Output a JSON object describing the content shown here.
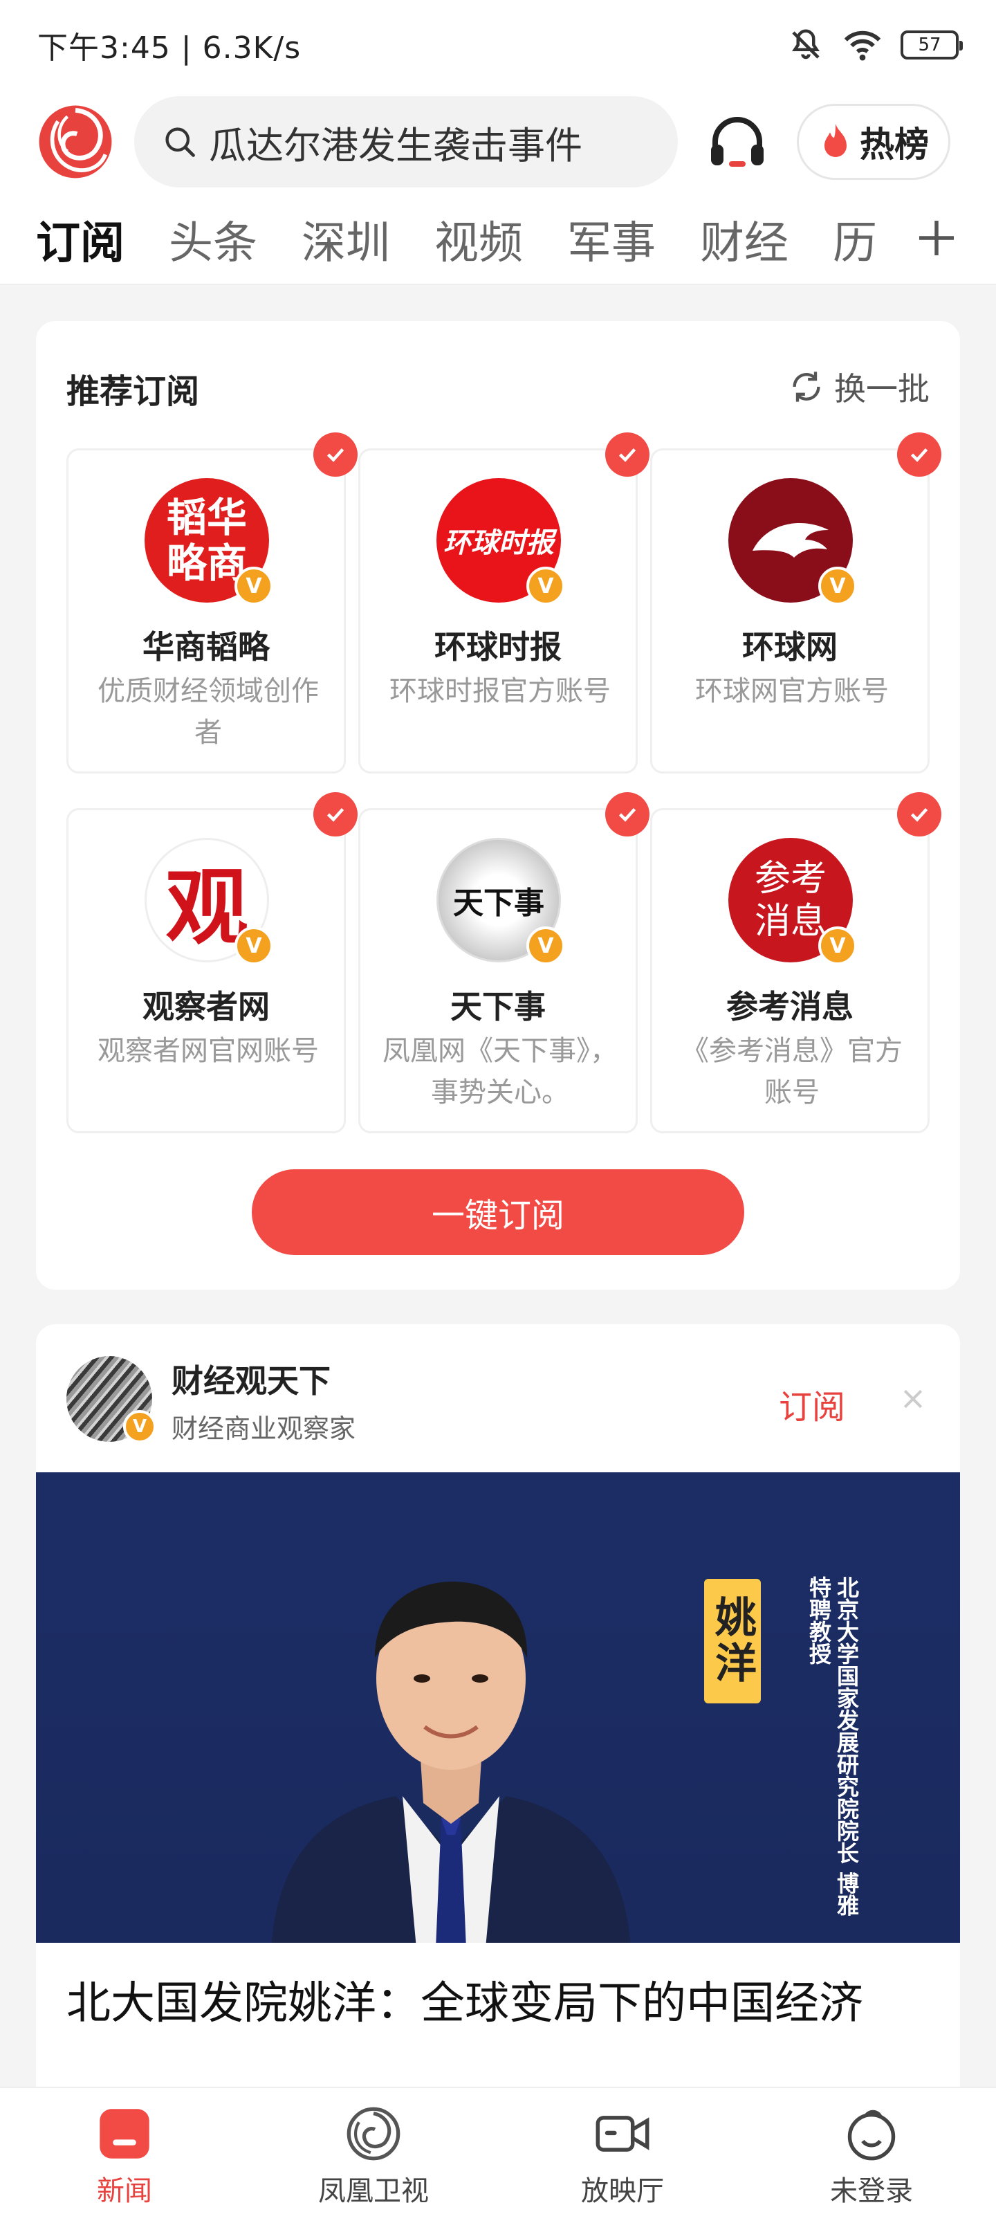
{
  "status_bar": {
    "time_speed": "下午3:45 | 6.3K/s",
    "battery": "57"
  },
  "header": {
    "search_text": "瓜达尔港发生袭击事件",
    "hot_label": "热榜"
  },
  "tabs": [
    "订阅",
    "头条",
    "深圳",
    "视频",
    "军事",
    "财经",
    "历"
  ],
  "recommend": {
    "title": "推荐订阅",
    "refresh_label": "换一批",
    "items": [
      {
        "name": "华商韬略",
        "desc": "优质财经领域创作者",
        "logo_text": "韬华略商"
      },
      {
        "name": "环球时报",
        "desc": "环球时报官方账号",
        "logo_text": "环球时报"
      },
      {
        "name": "环球网",
        "desc": "环球网官方账号",
        "logo_text": ""
      },
      {
        "name": "观察者网",
        "desc": "观察者网官网账号",
        "logo_text": "观"
      },
      {
        "name": "天下事",
        "desc": "凤凰网《天下事》，事势关心。",
        "logo_text": "天下事"
      },
      {
        "name": "参考消息",
        "desc": "《参考消息》官方账号",
        "logo_text": "参考消息"
      }
    ],
    "subscribe_all": "一键订阅",
    "verified_mark": "V"
  },
  "feed": {
    "author": "财经观天下",
    "author_desc": "财经商业观察家",
    "follow_label": "订阅",
    "cover_name": "姚洋",
    "cover_title": "北京大学国家发展研究院院长 博雅特聘教授",
    "title": "北大国发院姚洋：全球变局下的中国经济"
  },
  "bottom_nav": [
    {
      "label": "新闻",
      "icon": "news-icon"
    },
    {
      "label": "凤凰卫视",
      "icon": "phoenix-tv-icon"
    },
    {
      "label": "放映厅",
      "icon": "video-camera-icon"
    },
    {
      "label": "未登录",
      "icon": "user-icon"
    }
  ],
  "colors": {
    "accent": "#f24a45",
    "verified": "#f4a11f"
  }
}
